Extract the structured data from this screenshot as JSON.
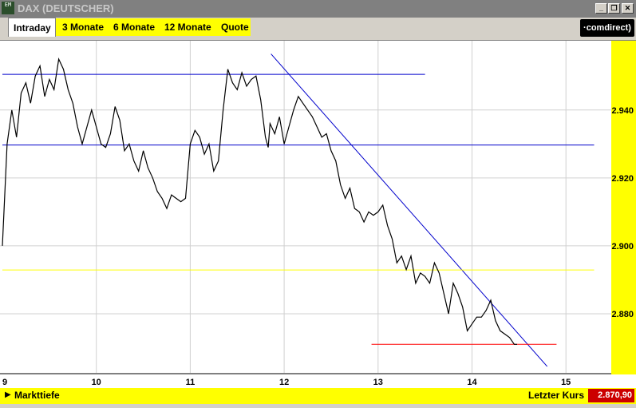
{
  "window": {
    "icon_text": "EM",
    "title": "DAX (DEUTSCHER)",
    "minimize_label": "_",
    "restore_label": "❐",
    "close_label": "✕"
  },
  "tabs": [
    {
      "label": "Intraday",
      "active": true
    },
    {
      "label": "3 Monate",
      "active": false
    },
    {
      "label": "6 Monate",
      "active": false
    },
    {
      "label": "12 Monate",
      "active": false
    },
    {
      "label": "Quote",
      "active": false
    }
  ],
  "brand": {
    "label": "·comdirect)"
  },
  "bottom": {
    "arrow_icon": "triangle-right-icon",
    "left_label": "Markttiefe",
    "right_label": "Letzter Kurs",
    "last_value": "2.870,90"
  },
  "colors": {
    "accent_yellow": "#ffff00",
    "trend_line": "#0000cc",
    "support_line": "#ff0000",
    "price_line": "#000000",
    "last_value_bg": "#cc0000"
  },
  "chart_data": {
    "type": "line",
    "title": "",
    "xlabel": "",
    "ylabel": "",
    "x_ticks": [
      "9",
      "10",
      "11",
      "12",
      "13",
      "14",
      "15"
    ],
    "y_ticks": [
      "2.940",
      "2.920",
      "2.900",
      "2.880"
    ],
    "xlim": [
      9,
      15.3
    ],
    "ylim": [
      2.8626,
      2.9604
    ],
    "grid": true,
    "series": [
      {
        "x": [
          9.0,
          9.05,
          9.1,
          9.15,
          9.2,
          9.25,
          9.3,
          9.35,
          9.4,
          9.45,
          9.5,
          9.55,
          9.6,
          9.65,
          9.7,
          9.75,
          9.8,
          9.85,
          9.9,
          9.95,
          10.0,
          10.05,
          10.1,
          10.15,
          10.2,
          10.25,
          10.3,
          10.35,
          10.4,
          10.45,
          10.5,
          10.55,
          10.6,
          10.65,
          10.7,
          10.75,
          10.8,
          10.85,
          10.9,
          10.95,
          11.0,
          11.05,
          11.1,
          11.15,
          11.2,
          11.25,
          11.3,
          11.35,
          11.4,
          11.45,
          11.5,
          11.55,
          11.6,
          11.65,
          11.7,
          11.75,
          11.8,
          11.83,
          11.85,
          11.9,
          11.95,
          12.0,
          12.05,
          12.1,
          12.15,
          12.2,
          12.25,
          12.3,
          12.35,
          12.4,
          12.45,
          12.5,
          12.55,
          12.6,
          12.65,
          12.7,
          12.75,
          12.8,
          12.85,
          12.9,
          12.95,
          13.0,
          13.05,
          13.1,
          13.15,
          13.2,
          13.25,
          13.3,
          13.35,
          13.4,
          13.45,
          13.5,
          13.55,
          13.6,
          13.65,
          13.7,
          13.75,
          13.8,
          13.85,
          13.9,
          13.95,
          14.0,
          14.05,
          14.1,
          14.15,
          14.2,
          14.25,
          14.3,
          14.35,
          14.4,
          14.45,
          14.48
        ],
        "y": [
          2.9,
          2.93,
          2.94,
          2.932,
          2.945,
          2.948,
          2.942,
          2.95,
          2.953,
          2.944,
          2.949,
          2.946,
          2.955,
          2.952,
          2.946,
          2.942,
          2.935,
          2.93,
          2.935,
          2.94,
          2.935,
          2.93,
          2.929,
          2.933,
          2.941,
          2.937,
          2.928,
          2.93,
          2.925,
          2.922,
          2.928,
          2.923,
          2.92,
          2.916,
          2.914,
          2.911,
          2.915,
          2.914,
          2.913,
          2.914,
          2.93,
          2.934,
          2.932,
          2.927,
          2.93,
          2.922,
          2.925,
          2.94,
          2.952,
          2.948,
          2.946,
          2.951,
          2.947,
          2.949,
          2.95,
          2.943,
          2.932,
          2.929,
          2.936,
          2.933,
          2.938,
          2.93,
          2.935,
          2.94,
          2.944,
          2.942,
          2.94,
          2.938,
          2.935,
          2.932,
          2.933,
          2.928,
          2.925,
          2.918,
          2.914,
          2.917,
          2.911,
          2.91,
          2.907,
          2.91,
          2.909,
          2.91,
          2.912,
          2.906,
          2.902,
          2.895,
          2.897,
          2.893,
          2.897,
          2.889,
          2.892,
          2.891,
          2.889,
          2.895,
          2.892,
          2.886,
          2.88,
          2.889,
          2.886,
          2.882,
          2.875,
          2.877,
          2.879,
          2.879,
          2.881,
          2.884,
          2.878,
          2.875,
          2.874,
          2.873,
          2.871,
          2.871
        ]
      }
    ],
    "overlays": [
      {
        "kind": "resistance",
        "color": "#0000cc",
        "x": [
          9.0,
          13.5
        ],
        "y": [
          2.9505,
          2.9505
        ]
      },
      {
        "kind": "resistance",
        "color": "#0000cc",
        "x": [
          9.0,
          15.3
        ],
        "y": [
          2.9297,
          2.9297
        ]
      },
      {
        "kind": "trend",
        "color": "#0000cc",
        "x": [
          11.86,
          14.8
        ],
        "y": [
          2.9565,
          2.8645
        ]
      },
      {
        "kind": "support",
        "color": "#ff0000",
        "x": [
          12.93,
          14.9
        ],
        "y": [
          2.871,
          2.871
        ]
      },
      {
        "kind": "reference",
        "color": "#ffff00",
        "x": [
          9.0,
          15.3
        ],
        "y": [
          2.8929,
          2.8929
        ]
      }
    ]
  }
}
